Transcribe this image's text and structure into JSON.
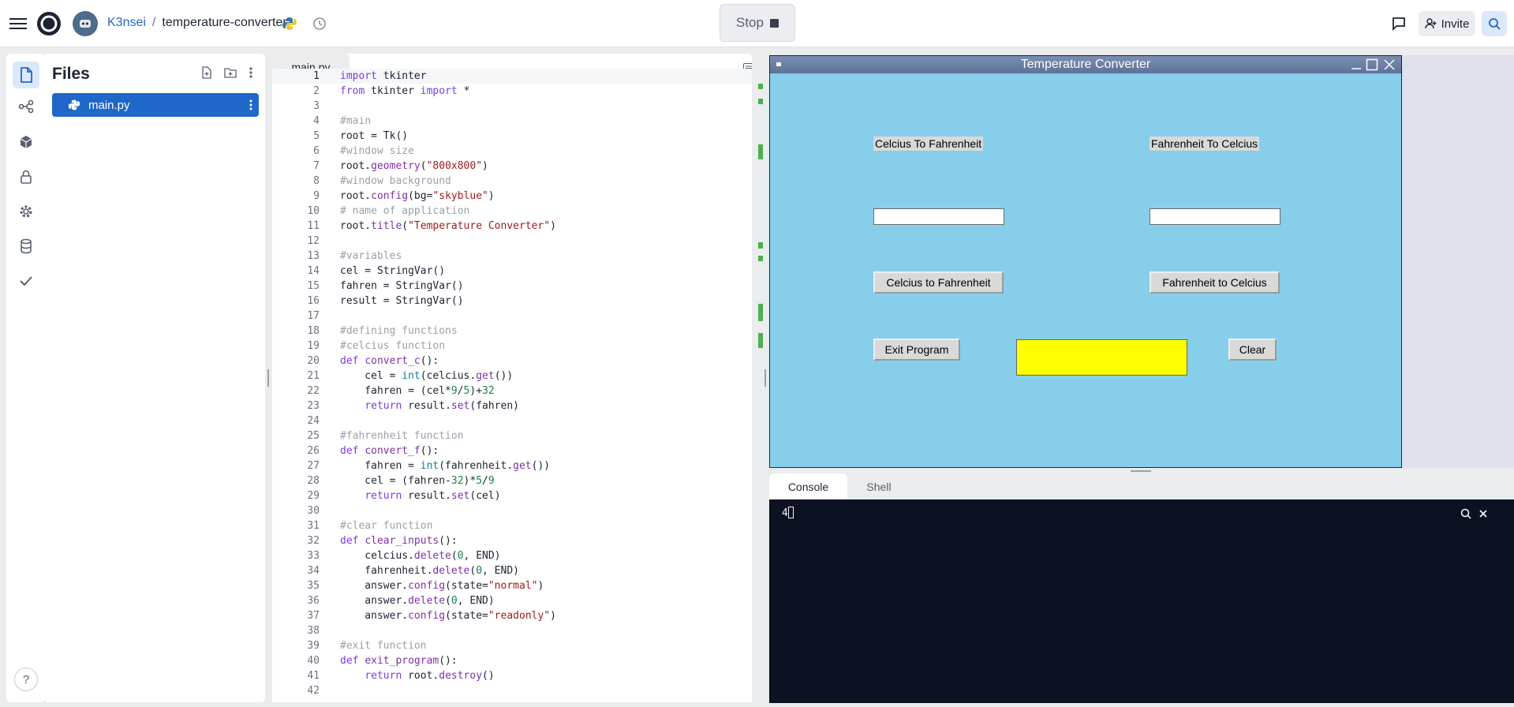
{
  "topbar": {
    "user": "K3nsei",
    "separator": "/",
    "repl_name": "temperature-converter",
    "stop_label": "Stop",
    "invite_label": "Invite"
  },
  "files_panel": {
    "title": "Files",
    "files": [
      {
        "name": "main.py",
        "icon": "python-icon"
      }
    ]
  },
  "editor": {
    "tab_label": "main.py",
    "current_line": 1,
    "lines": [
      "import tkinter",
      "from tkinter import *",
      "",
      "#main",
      "root = Tk()",
      "#window size",
      "root.geometry(\"800x800\")",
      "#window background",
      "root.config(bg=\"skyblue\")",
      "# name of application",
      "root.title(\"Temperature Converter\")",
      "",
      "#variables",
      "cel = StringVar()",
      "fahren = StringVar()",
      "result = StringVar()",
      "",
      "#defining functions",
      "#celcius function",
      "def convert_c():",
      "    cel = int(celcius.get())",
      "    fahren = (cel*9/5)+32",
      "    return result.set(fahren)",
      "",
      "#fahrenheit function",
      "def convert_f():",
      "    fahren = int(fahrenheit.get())",
      "    cel = (fahren-32)*5/9",
      "    return result.set(cel)",
      "",
      "#clear function",
      "def clear_inputs():",
      "    celcius.delete(0, END)",
      "    fahrenheit.delete(0, END)",
      "    answer.config(state=\"normal\")",
      "    answer.delete(0, END)",
      "    answer.config(state=\"readonly\")",
      "",
      "#exit function",
      "def exit_program():",
      "    return root.destroy()",
      ""
    ]
  },
  "tk_window": {
    "title": "Temperature Converter",
    "label_c_to_f": "Celcius To Fahrenheit",
    "label_f_to_c": "Fahrenheit To Celcius",
    "celcius_value": "",
    "fahrenheit_value": "",
    "btn_c_to_f": "Celcius to Fahrenheit",
    "btn_f_to_c": "Fahrenheit to Celcius",
    "btn_exit": "Exit Program",
    "btn_clear": "Clear",
    "answer_value": "",
    "background_color": "#87ceeb",
    "answer_color": "#ffff00"
  },
  "console_panel": {
    "tabs": [
      {
        "label": "Console",
        "active": true
      },
      {
        "label": "Shell",
        "active": false
      }
    ],
    "output": "4"
  },
  "colors": {
    "accent": "#1f67c9",
    "console_bg": "#0d1222"
  }
}
